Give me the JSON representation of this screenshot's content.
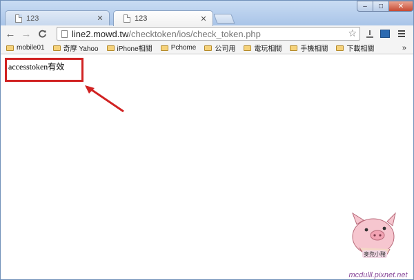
{
  "tabs": [
    {
      "label": "123",
      "active": false
    },
    {
      "label": "123",
      "active": true
    }
  ],
  "window_controls": {
    "minimize": "–",
    "maximize": "□",
    "close": "✕"
  },
  "nav": {
    "back": "←",
    "forward": "→",
    "reload": "C"
  },
  "address": {
    "host": "line2.mowd.tw",
    "path": "/checktoken/ios/check_token.php"
  },
  "bookmarks": {
    "items": [
      {
        "label": "mobile01",
        "icon": "folder-icon"
      },
      {
        "label": "奇摩 Yahoo",
        "icon": "folder-icon"
      },
      {
        "label": "iPhone相關",
        "icon": "folder-icon"
      },
      {
        "label": "Pchome",
        "icon": "folder-icon"
      },
      {
        "label": "公司用",
        "icon": "folder-icon"
      },
      {
        "label": "電玩相關",
        "icon": "folder-icon"
      },
      {
        "label": "手機相關",
        "icon": "folder-icon"
      },
      {
        "label": "下載相關",
        "icon": "folder-icon"
      }
    ],
    "more": "»"
  },
  "page": {
    "message": "accesstoken有效"
  },
  "annotation": {
    "box_color": "#d12222",
    "arrow_color": "#d12222"
  },
  "watermark": {
    "text": "mcdulll.pixnet.net",
    "badge": "麥兜小豬"
  },
  "colors": {
    "titlebar": "#b7cfee",
    "accent": "#d12222"
  }
}
